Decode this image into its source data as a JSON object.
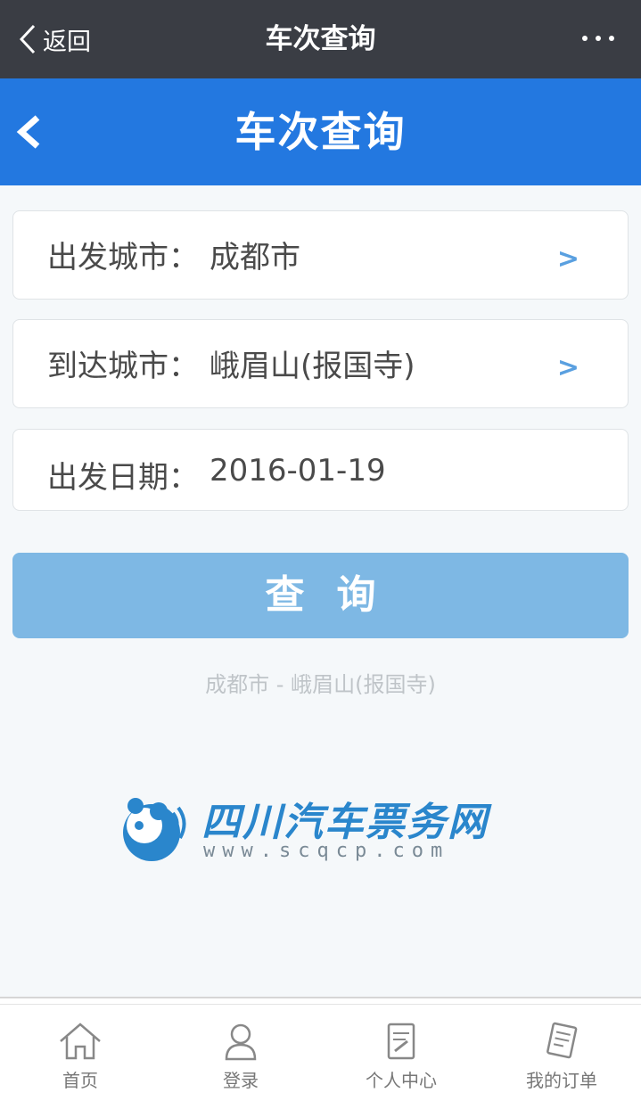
{
  "wechat_bar": {
    "back_label": "返回",
    "title": "车次查询"
  },
  "header": {
    "title": "车次查询"
  },
  "form": {
    "departure": {
      "label": "出发城市：",
      "value": "成都市",
      "arrow": ">"
    },
    "arrival": {
      "label": "到达城市：",
      "value": "峨眉山(报国寺)",
      "arrow": ">"
    },
    "date": {
      "label": "出发日期：",
      "value": "2016-01-19"
    }
  },
  "search_button": {
    "label": "查询"
  },
  "route_summary": "成都市 - 峨眉山(报国寺)",
  "logo": {
    "name": "四川汽车票务网",
    "url": "www.scqcp.com"
  },
  "tabbar": {
    "items": [
      {
        "label": "首页",
        "icon": "home-icon"
      },
      {
        "label": "登录",
        "icon": "user-icon"
      },
      {
        "label": "个人中心",
        "icon": "edit-doc-icon"
      },
      {
        "label": "我的订单",
        "icon": "order-icon"
      }
    ]
  },
  "colors": {
    "wechat_bar": "#3a3d44",
    "header": "#2378e0",
    "button": "#7eb8e4",
    "logo": "#2a86cc"
  }
}
